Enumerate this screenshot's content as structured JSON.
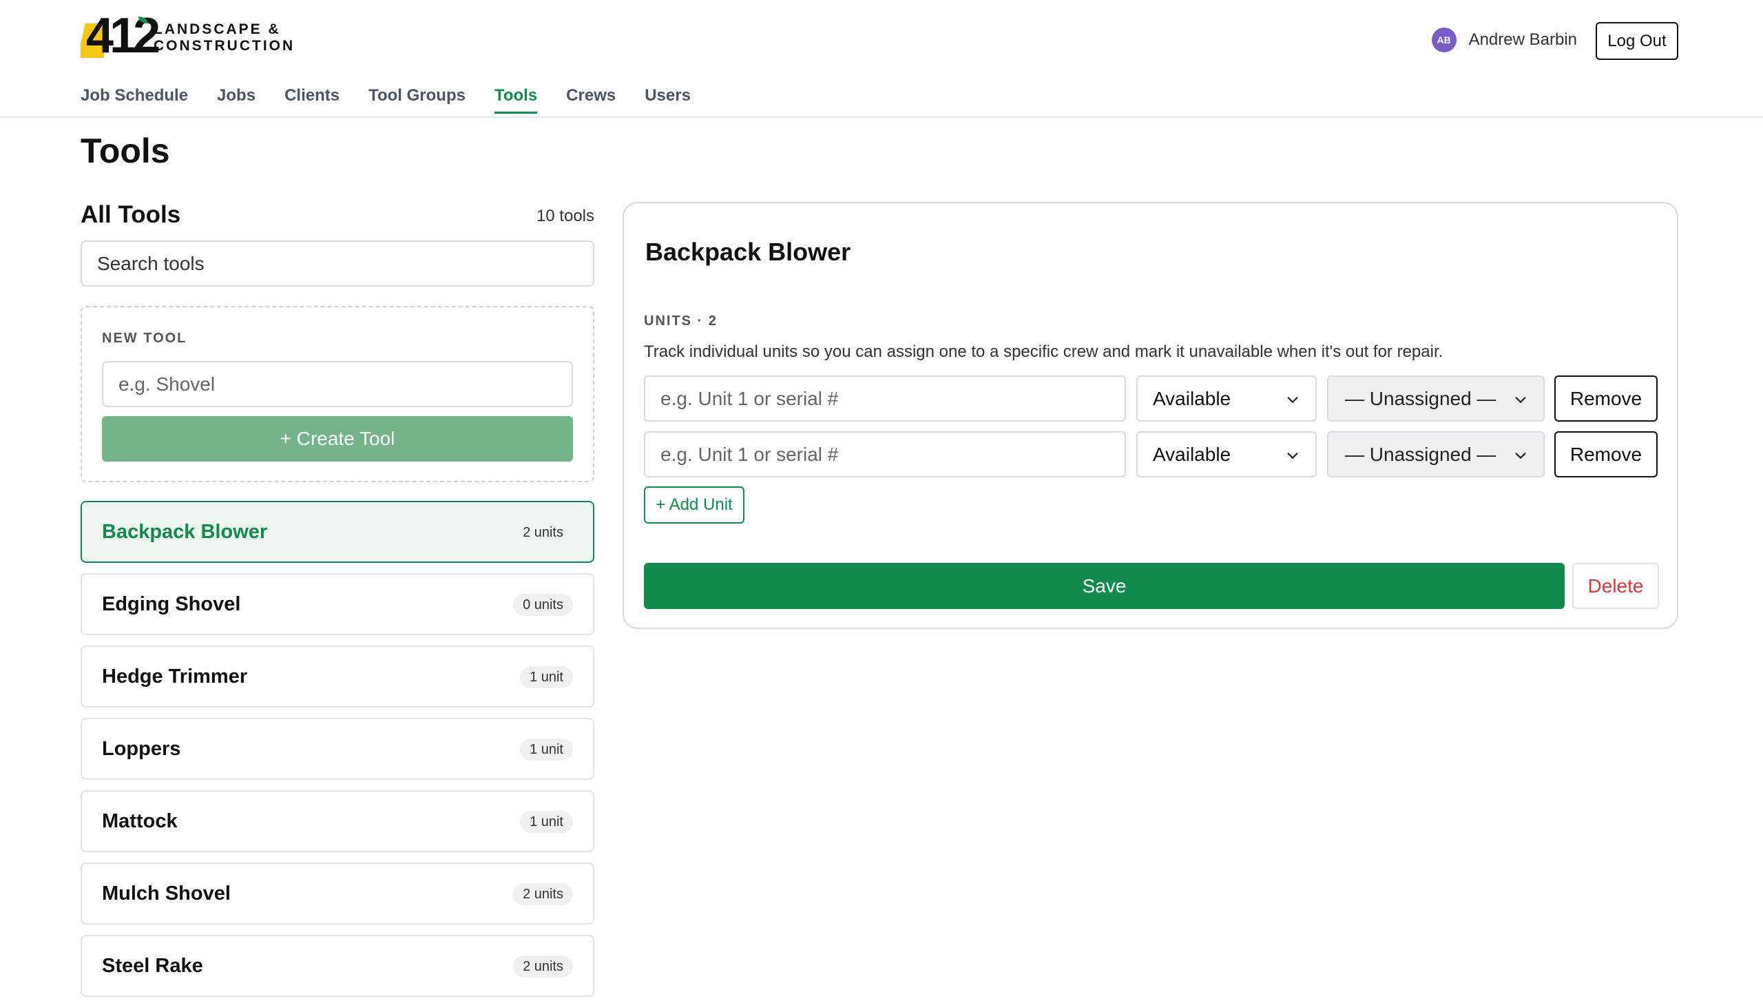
{
  "brand": {
    "logo_number": "412",
    "logo_line1": "LANDSCAPE &",
    "logo_line2": "CONSTRUCTION",
    "colors": {
      "accent": "#138a4d",
      "logo_yellow": "#f2c716",
      "danger": "#d23b3b"
    }
  },
  "user": {
    "initials": "AB",
    "name": "Andrew Barbin",
    "logout_label": "Log Out"
  },
  "nav": {
    "items": [
      {
        "label": "Job Schedule",
        "active": false
      },
      {
        "label": "Jobs",
        "active": false
      },
      {
        "label": "Clients",
        "active": false
      },
      {
        "label": "Tool Groups",
        "active": false
      },
      {
        "label": "Tools",
        "active": true
      },
      {
        "label": "Crews",
        "active": false
      },
      {
        "label": "Users",
        "active": false
      }
    ]
  },
  "page": {
    "title": "Tools"
  },
  "left": {
    "heading": "All Tools",
    "count": "10 tools",
    "search_placeholder": "Search tools",
    "new_tool": {
      "label": "NEW TOOL",
      "placeholder": "e.g. Shovel",
      "create_label": "+ Create Tool"
    },
    "tools": [
      {
        "name": "Backpack Blower",
        "units": "2 units",
        "selected": true
      },
      {
        "name": "Edging Shovel",
        "units": "0 units",
        "selected": false
      },
      {
        "name": "Hedge Trimmer",
        "units": "1 unit",
        "selected": false
      },
      {
        "name": "Loppers",
        "units": "1 unit",
        "selected": false
      },
      {
        "name": "Mattock",
        "units": "1 unit",
        "selected": false
      },
      {
        "name": "Mulch Shovel",
        "units": "2 units",
        "selected": false
      },
      {
        "name": "Steel Rake",
        "units": "2 units",
        "selected": false
      }
    ]
  },
  "detail": {
    "title": "Backpack Blower",
    "units_label": "UNITS · 2",
    "units_help": "Track individual units so you can assign one to a specific crew and mark it unavailable when it's out for repair.",
    "units": [
      {
        "placeholder": "e.g. Unit 1 or serial #",
        "status": "Available",
        "crew": "— Unassigned —",
        "remove_label": "Remove"
      },
      {
        "placeholder": "e.g. Unit 1 or serial #",
        "status": "Available",
        "crew": "— Unassigned —",
        "remove_label": "Remove"
      }
    ],
    "add_unit_label": "+ Add Unit",
    "save_label": "Save",
    "delete_label": "Delete"
  }
}
